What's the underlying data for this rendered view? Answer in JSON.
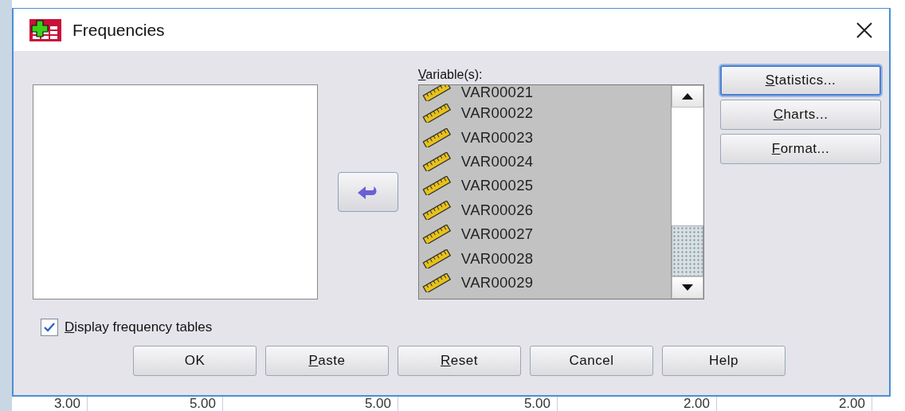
{
  "window": {
    "title": "Frequencies"
  },
  "variables": {
    "key": "V",
    "label": "ariable(s):",
    "items": [
      {
        "name": "VAR00021"
      },
      {
        "name": "VAR00022"
      },
      {
        "name": "VAR00023"
      },
      {
        "name": "VAR00024"
      },
      {
        "name": "VAR00025"
      },
      {
        "name": "VAR00026"
      },
      {
        "name": "VAR00027"
      },
      {
        "name": "VAR00028"
      },
      {
        "name": "VAR00029"
      }
    ]
  },
  "side_buttons": [
    {
      "key": "S",
      "label": "tatistics...",
      "focused": true
    },
    {
      "key": "C",
      "label": "harts...",
      "focused": false
    },
    {
      "key": "F",
      "label": "ormat...",
      "focused": false
    }
  ],
  "display_tables": {
    "key": "D",
    "label": "isplay frequency tables",
    "checked": true
  },
  "buttons": [
    {
      "label": "OK"
    },
    {
      "key": "P",
      "label": "aste"
    },
    {
      "key": "R",
      "label": "eset"
    },
    {
      "label": "Cancel"
    },
    {
      "label": "Help"
    }
  ],
  "background_row": [
    "3.00",
    "5.00",
    "5.00",
    "5.00",
    "2.00",
    "2.00"
  ]
}
